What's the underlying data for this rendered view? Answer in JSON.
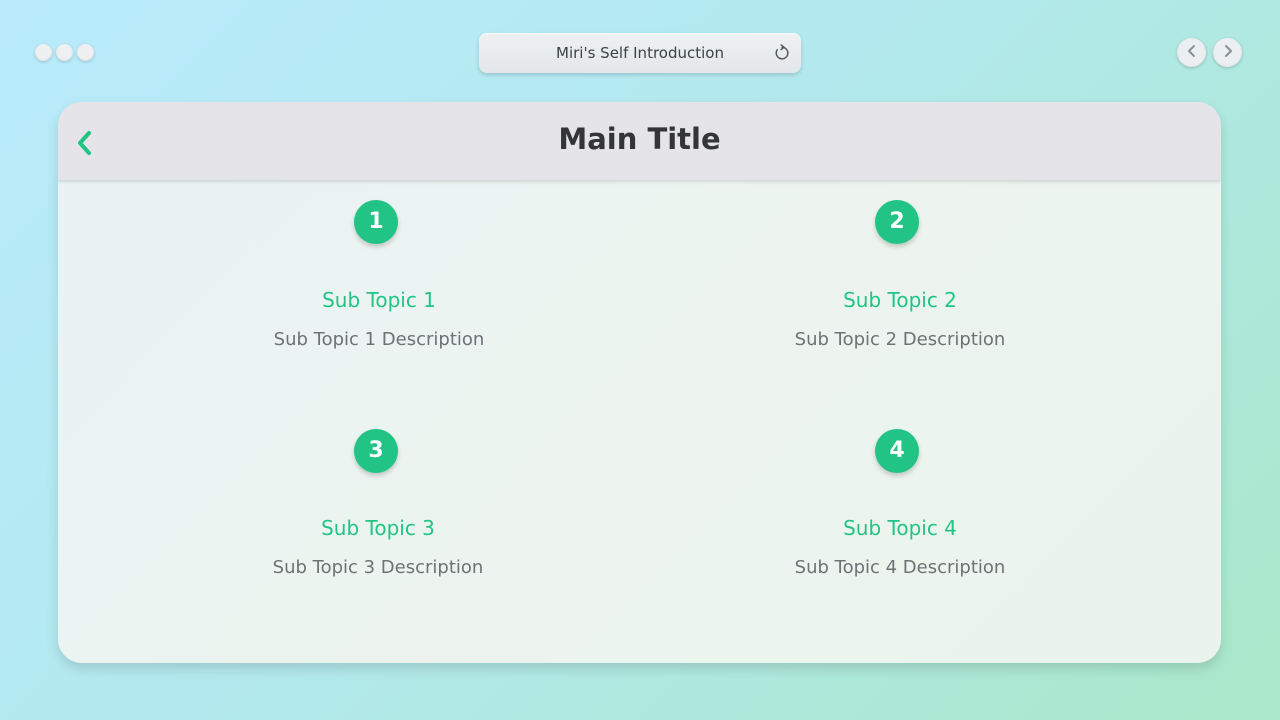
{
  "window": {
    "title": "Miri's Self Introduction"
  },
  "slide": {
    "title": "Main Title"
  },
  "topics": [
    {
      "number": "1",
      "title": "Sub Topic 1",
      "description": "Sub Topic 1 Description"
    },
    {
      "number": "2",
      "title": "Sub Topic 2",
      "description": "Sub Topic 2 Description"
    },
    {
      "number": "3",
      "title": "Sub Topic 3",
      "description": "Sub Topic 3 Description"
    },
    {
      "number": "4",
      "title": "Sub Topic 4",
      "description": "Sub Topic 4 Description"
    }
  ],
  "icons": {
    "back": "chevron-left-icon",
    "reload": "reload-icon",
    "prev": "chevron-left-icon",
    "next": "chevron-right-icon"
  },
  "colors": {
    "accent": "#21c484",
    "title_text": "#333538",
    "description_text": "#6d7275"
  }
}
